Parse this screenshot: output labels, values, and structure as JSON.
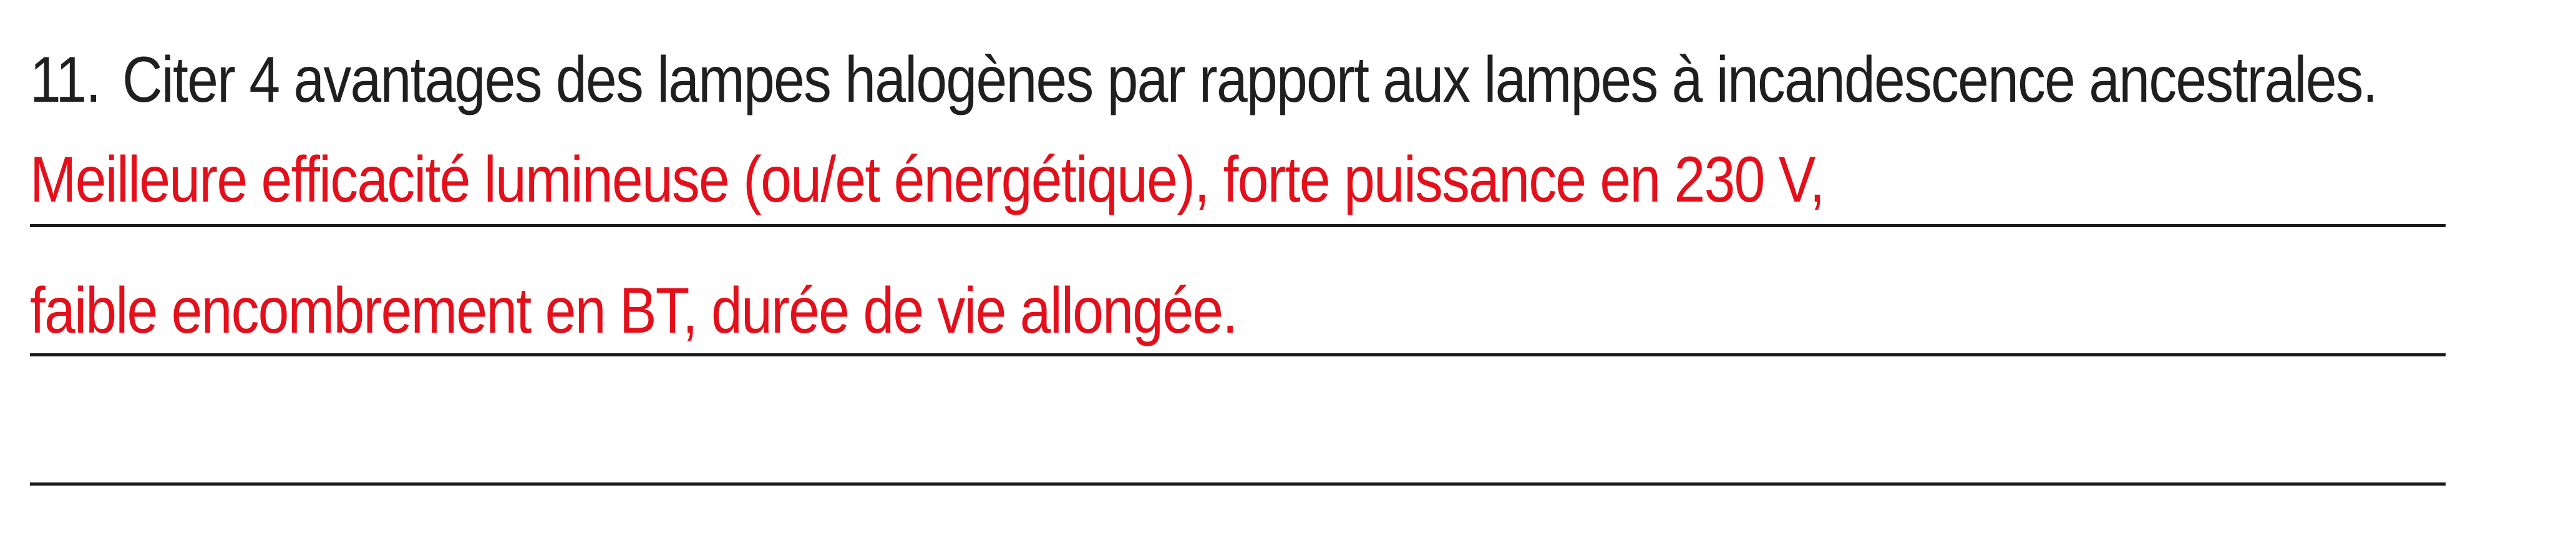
{
  "question": {
    "number": "11.",
    "text": "Citer 4 avantages des lampes halogènes par rapport aux lampes à incandescence ancestrales."
  },
  "answer": {
    "lines": [
      "Meilleure efficacité lumineuse (ou/et énergétique), forte puissance en 230 V,",
      "faible encombrement en BT, durée de vie allongée.",
      ""
    ]
  },
  "colors": {
    "question_text": "#1f1f1f",
    "answer_text": "#e3101b",
    "rule": "#1a1a1a"
  }
}
